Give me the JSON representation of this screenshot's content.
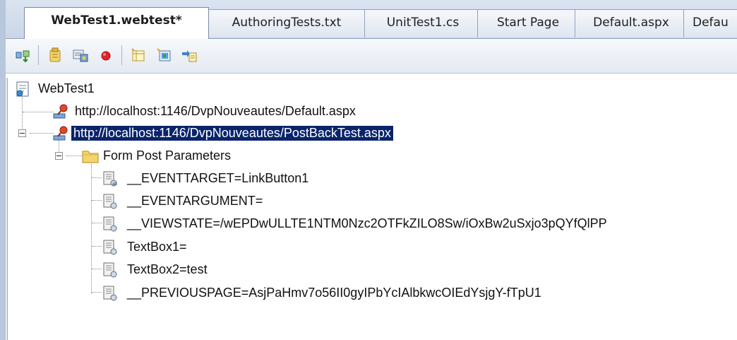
{
  "tabs": [
    {
      "label": "WebTest1.webtest*",
      "active": true
    },
    {
      "label": "AuthoringTests.txt",
      "active": false
    },
    {
      "label": "UnitTest1.cs",
      "active": false
    },
    {
      "label": "Start Page",
      "active": false
    },
    {
      "label": "Default.aspx",
      "active": false
    },
    {
      "label": "Defau",
      "active": false
    }
  ],
  "toolbar": {
    "icons": [
      "run-test-icon",
      "add-rule-icon",
      "parameterize-icon",
      "record-icon",
      "add-datasource-icon",
      "add-request-icon",
      "insert-transaction-icon"
    ]
  },
  "tree": {
    "root": {
      "label": "WebTest1",
      "icon": "webtest-icon"
    },
    "requests": [
      {
        "label": "http://localhost:1146/DvpNouveautes/Default.aspx",
        "icon": "request-icon"
      },
      {
        "label": "http://localhost:1146/DvpNouveautes/PostBackTest.aspx",
        "icon": "request-icon",
        "selected": true
      }
    ],
    "form_post": {
      "label": "Form Post Parameters",
      "icon": "folder-icon"
    },
    "params": [
      "__EVENTTARGET=LinkButton1",
      "__EVENTARGUMENT=",
      "__VIEWSTATE=/wEPDwULLTE1NTM0Nzc2OTFkZILO8Sw/iOxBw2uSxjo3pQYfQlPP",
      "TextBox1=",
      "TextBox2=test",
      "__PREVIOUSPAGE=AsjPaHmv7o56II0gyIPbYcIAlbkwcOIEdYsjgY-fTpU1"
    ]
  },
  "colors": {
    "selection": "#0a246a",
    "tabstrip": "#c9d6e8"
  }
}
